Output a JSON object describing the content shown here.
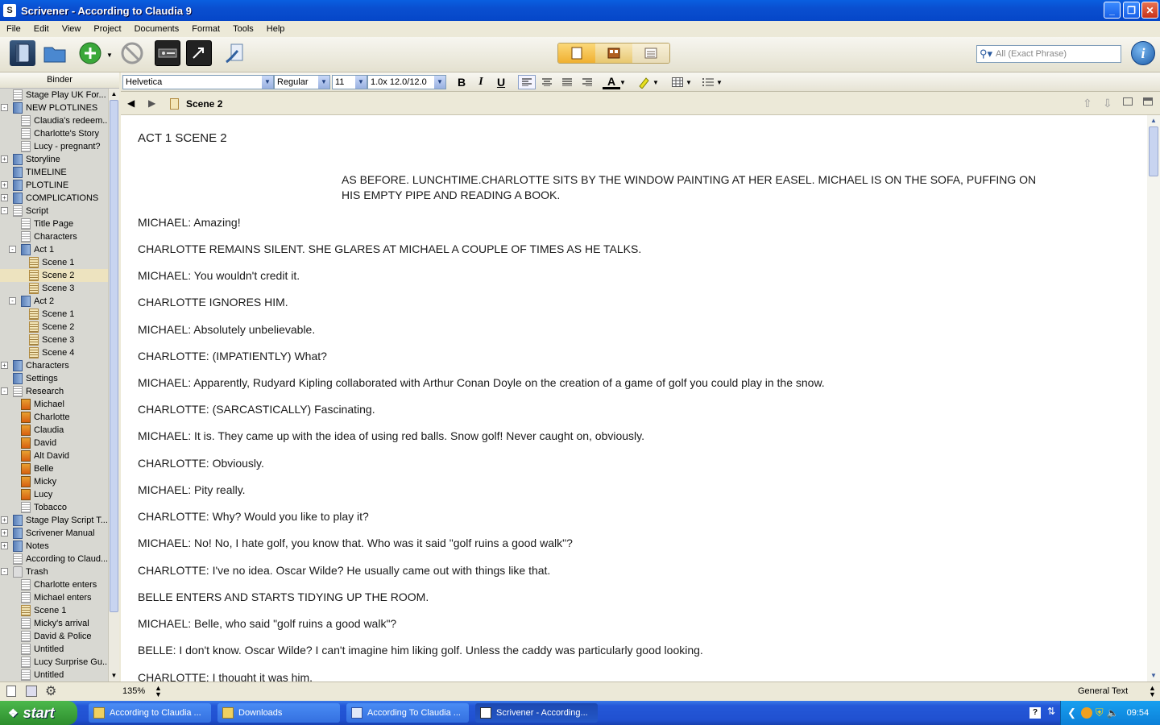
{
  "window": {
    "title": "Scrivener - According to Claudia 9"
  },
  "menu": [
    "File",
    "Edit",
    "View",
    "Project",
    "Documents",
    "Format",
    "Tools",
    "Help"
  ],
  "search": {
    "placeholder": "All (Exact Phrase)"
  },
  "binder": {
    "header": "Binder",
    "items": [
      {
        "label": "Stage Play UK For...",
        "icon": "doc",
        "depth": 1,
        "expander": ""
      },
      {
        "label": "NEW PLOTLINES",
        "icon": "folder",
        "depth": 1,
        "expander": "-"
      },
      {
        "label": "Claudia's redeem...",
        "icon": "doc",
        "depth": 2,
        "expander": ""
      },
      {
        "label": "Charlotte's Story",
        "icon": "doc",
        "depth": 2,
        "expander": ""
      },
      {
        "label": "Lucy - pregnant?",
        "icon": "doc",
        "depth": 2,
        "expander": ""
      },
      {
        "label": "Storyline",
        "icon": "folder",
        "depth": 1,
        "expander": "+"
      },
      {
        "label": "TIMELINE",
        "icon": "folder",
        "depth": 1,
        "expander": ""
      },
      {
        "label": "PLOTLINE",
        "icon": "folder",
        "depth": 1,
        "expander": "+"
      },
      {
        "label": "COMPLICATIONS",
        "icon": "folder",
        "depth": 1,
        "expander": "+"
      },
      {
        "label": "Script",
        "icon": "doc",
        "depth": 1,
        "expander": "-"
      },
      {
        "label": "Title Page",
        "icon": "doc",
        "depth": 2,
        "expander": ""
      },
      {
        "label": "Characters",
        "icon": "doc",
        "depth": 2,
        "expander": ""
      },
      {
        "label": "Act 1",
        "icon": "folder",
        "depth": 2,
        "expander": "-"
      },
      {
        "label": "Scene 1",
        "icon": "scene",
        "depth": 3,
        "expander": ""
      },
      {
        "label": "Scene 2",
        "icon": "scene",
        "depth": 3,
        "expander": "",
        "selected": true
      },
      {
        "label": "Scene 3",
        "icon": "scene",
        "depth": 3,
        "expander": ""
      },
      {
        "label": "Act 2",
        "icon": "folder",
        "depth": 2,
        "expander": "-"
      },
      {
        "label": "Scene 1",
        "icon": "scene",
        "depth": 3,
        "expander": ""
      },
      {
        "label": "Scene 2",
        "icon": "scene",
        "depth": 3,
        "expander": ""
      },
      {
        "label": "Scene 3",
        "icon": "scene",
        "depth": 3,
        "expander": ""
      },
      {
        "label": "Scene 4",
        "icon": "scene",
        "depth": 3,
        "expander": ""
      },
      {
        "label": "Characters",
        "icon": "folder",
        "depth": 1,
        "expander": "+"
      },
      {
        "label": "Settings",
        "icon": "folder",
        "depth": 1,
        "expander": ""
      },
      {
        "label": "Research",
        "icon": "doc",
        "depth": 1,
        "expander": "-"
      },
      {
        "label": "Michael",
        "icon": "img",
        "depth": 2,
        "expander": ""
      },
      {
        "label": "Charlotte",
        "icon": "img",
        "depth": 2,
        "expander": ""
      },
      {
        "label": "Claudia",
        "icon": "img",
        "depth": 2,
        "expander": ""
      },
      {
        "label": "David",
        "icon": "img",
        "depth": 2,
        "expander": ""
      },
      {
        "label": "Alt David",
        "icon": "img",
        "depth": 2,
        "expander": ""
      },
      {
        "label": "Belle",
        "icon": "img",
        "depth": 2,
        "expander": ""
      },
      {
        "label": "Micky",
        "icon": "img",
        "depth": 2,
        "expander": ""
      },
      {
        "label": "Lucy",
        "icon": "img",
        "depth": 2,
        "expander": ""
      },
      {
        "label": "Tobacco",
        "icon": "doc",
        "depth": 2,
        "expander": ""
      },
      {
        "label": "Stage Play Script T...",
        "icon": "folder",
        "depth": 1,
        "expander": "+"
      },
      {
        "label": "Scrivener Manual",
        "icon": "folder",
        "depth": 1,
        "expander": "+"
      },
      {
        "label": "Notes",
        "icon": "folder",
        "depth": 1,
        "expander": "+"
      },
      {
        "label": "According to Claud...",
        "icon": "doc",
        "depth": 1,
        "expander": ""
      },
      {
        "label": "Trash",
        "icon": "trash",
        "depth": 1,
        "expander": "-"
      },
      {
        "label": "Charlotte enters",
        "icon": "doc",
        "depth": 2,
        "expander": ""
      },
      {
        "label": "Michael enters",
        "icon": "doc",
        "depth": 2,
        "expander": ""
      },
      {
        "label": "Scene 1",
        "icon": "scene",
        "depth": 2,
        "expander": ""
      },
      {
        "label": "Micky's arrival",
        "icon": "doc",
        "depth": 2,
        "expander": ""
      },
      {
        "label": "David & Police",
        "icon": "doc",
        "depth": 2,
        "expander": ""
      },
      {
        "label": "Untitled",
        "icon": "doc",
        "depth": 2,
        "expander": ""
      },
      {
        "label": "Lucy Surprise Gu...",
        "icon": "doc",
        "depth": 2,
        "expander": ""
      },
      {
        "label": "Untitled",
        "icon": "doc",
        "depth": 2,
        "expander": ""
      }
    ]
  },
  "format": {
    "font": "Helvetica",
    "style": "Regular",
    "size": "11",
    "spacing": "1.0x 12.0/12.0"
  },
  "editor": {
    "doc_title": "Scene 2",
    "heading": "ACT 1 SCENE 2",
    "direction_lines": [
      "AS BEFORE. LUNCHTIME.CHARLOTTE SITS BY THE WINDOW PAINTING AT HER EASEL. MICHAEL IS ON THE SOFA, PUFFING ON",
      "HIS EMPTY PIPE AND READING A BOOK."
    ],
    "lines": [
      "MICHAEL: Amazing!",
      "CHARLOTTE REMAINS SILENT. SHE GLARES AT MICHAEL  A COUPLE OF TIMES AS HE TALKS.",
      "MICHAEL: You wouldn't credit it.",
      "CHARLOTTE IGNORES HIM.",
      "MICHAEL: Absolutely unbelievable.",
      "CHARLOTTE: (IMPATIENTLY) What?",
      "MICHAEL: Apparently, Rudyard Kipling collaborated with Arthur Conan Doyle on the creation of a game of golf you could play in the snow.",
      "CHARLOTTE: (SARCASTICALLY) Fascinating.",
      "MICHAEL: It is. They came up with the idea of using red balls. Snow golf! Never caught on, obviously.",
      "CHARLOTTE: Obviously.",
      "MICHAEL: Pity really.",
      "CHARLOTTE: Why? Would you like to play it?",
      "MICHAEL: No! No, I hate golf, you know that.  Who was it said \"golf ruins a good walk\"?",
      "CHARLOTTE: I've no idea. Oscar Wilde? He usually came out with things like that.",
      "BELLE ENTERS AND STARTS TIDYING UP THE ROOM.",
      "MICHAEL: Belle, who said \"golf ruins a good walk\"?",
      "BELLE: I don't know. Oscar Wilde? I can't imagine him liking golf. Unless the caddy was particularly good looking.",
      "CHARLOTTE: I thought it was him."
    ]
  },
  "status": {
    "zoom": "135%",
    "text_type": "General Text"
  },
  "taskbar": {
    "start": "start",
    "tasks": [
      "According to Claudia ...",
      "Downloads",
      "According To Claudia ...",
      "Scrivener - According..."
    ],
    "clock": "09:54"
  }
}
